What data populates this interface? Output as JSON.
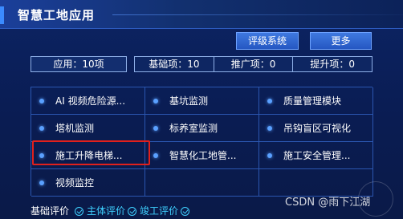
{
  "header": {
    "title": "智慧工地应用",
    "buttons": {
      "eval": "评级系统",
      "more": "更多"
    }
  },
  "counts": {
    "app": "应用：10项",
    "basic": "基础项：10",
    "promote": "推广项：0",
    "upgrade": "提升项：0"
  },
  "apps": [
    "AI 视频危险源...",
    "基坑监测",
    "质量管理模块",
    "塔机监测",
    "标养室监测",
    "吊钩盲区可视化",
    "施工升降电梯...",
    "智慧化工地管...",
    "施工安全管理...",
    "视频监控"
  ],
  "footer": {
    "label": "基础评价",
    "links": [
      "主体评价",
      "竣工评价"
    ]
  },
  "watermark": "CSDN @雨下江湖",
  "colors": {
    "background": "#0a1a45",
    "accent": "#3b8bff",
    "link": "#3fd0ff",
    "highlight": "#e0201c"
  }
}
